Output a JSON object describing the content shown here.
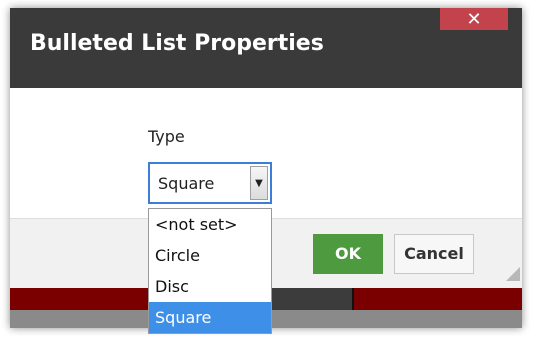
{
  "dialog": {
    "title": "Bulleted List Properties",
    "close_glyph": "✕"
  },
  "form": {
    "type_label": "Type",
    "type_select": {
      "selected_value": "Square",
      "options": [
        "<not set>",
        "Circle",
        "Disc",
        "Square"
      ],
      "highlighted_option": "Square"
    }
  },
  "footer": {
    "ok_label": "OK",
    "cancel_label": "Cancel"
  },
  "colors": {
    "titlebar": "#3a3a3a",
    "close_button": "#c2434b",
    "ok_button": "#4e9a3e",
    "select_focus_border": "#3b7dd8",
    "option_highlight": "#3d8fe8"
  }
}
